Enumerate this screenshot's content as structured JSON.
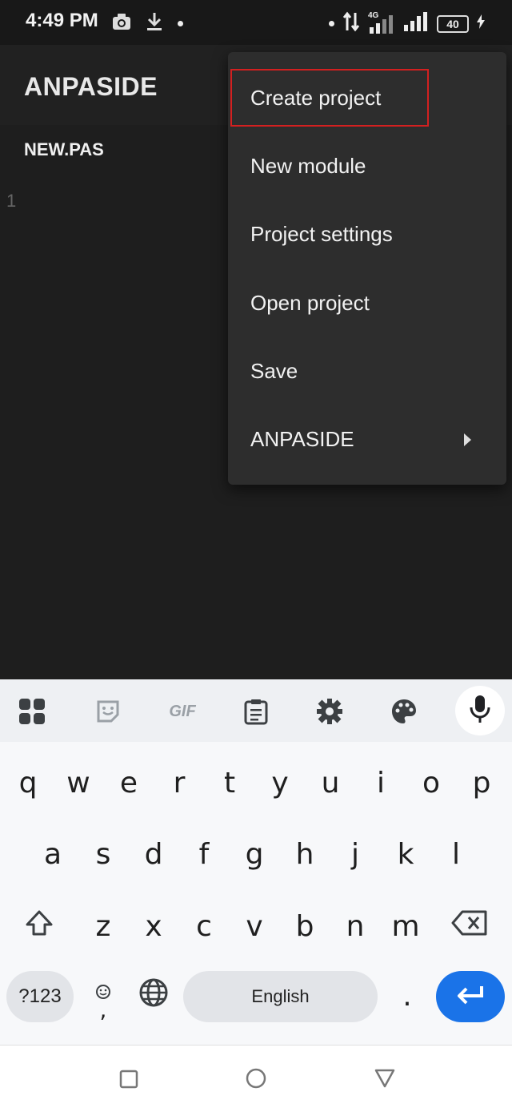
{
  "status_bar": {
    "time": "4:49 PM",
    "network": "4G",
    "battery": "40",
    "icons": [
      "camera-icon",
      "download-icon",
      "notification-dot",
      "data-transfer-icon",
      "signal-4g-icon",
      "signal-icon",
      "battery-icon",
      "charging-icon"
    ]
  },
  "app": {
    "title": "ANPASIDE",
    "tab": "NEW.PAS",
    "line_number": "1"
  },
  "menu": {
    "items": [
      {
        "label": "Create project",
        "highlighted": true
      },
      {
        "label": "New module"
      },
      {
        "label": "Project settings"
      },
      {
        "label": "Open project"
      },
      {
        "label": "Save"
      },
      {
        "label": "ANPASIDE",
        "has_submenu": true
      }
    ],
    "highlight_color": "#d32020"
  },
  "keyboard": {
    "toolbar": [
      "apps-grid-icon",
      "sticker-icon",
      "gif-icon",
      "clipboard-icon",
      "settings-icon",
      "palette-icon",
      "mic-icon"
    ],
    "gif_label": "GIF",
    "row1": [
      "q",
      "w",
      "e",
      "r",
      "t",
      "y",
      "u",
      "i",
      "o",
      "p"
    ],
    "row2": [
      "a",
      "s",
      "d",
      "f",
      "g",
      "h",
      "j",
      "k",
      "l"
    ],
    "row3": [
      "z",
      "x",
      "c",
      "v",
      "b",
      "n",
      "m"
    ],
    "symbols_label": "?123",
    "comma": ",",
    "space_label": "English",
    "period": ".",
    "accent_color": "#1a73e8"
  },
  "navbar": [
    "recents-square-icon",
    "home-circle-icon",
    "back-triangle-icon"
  ]
}
